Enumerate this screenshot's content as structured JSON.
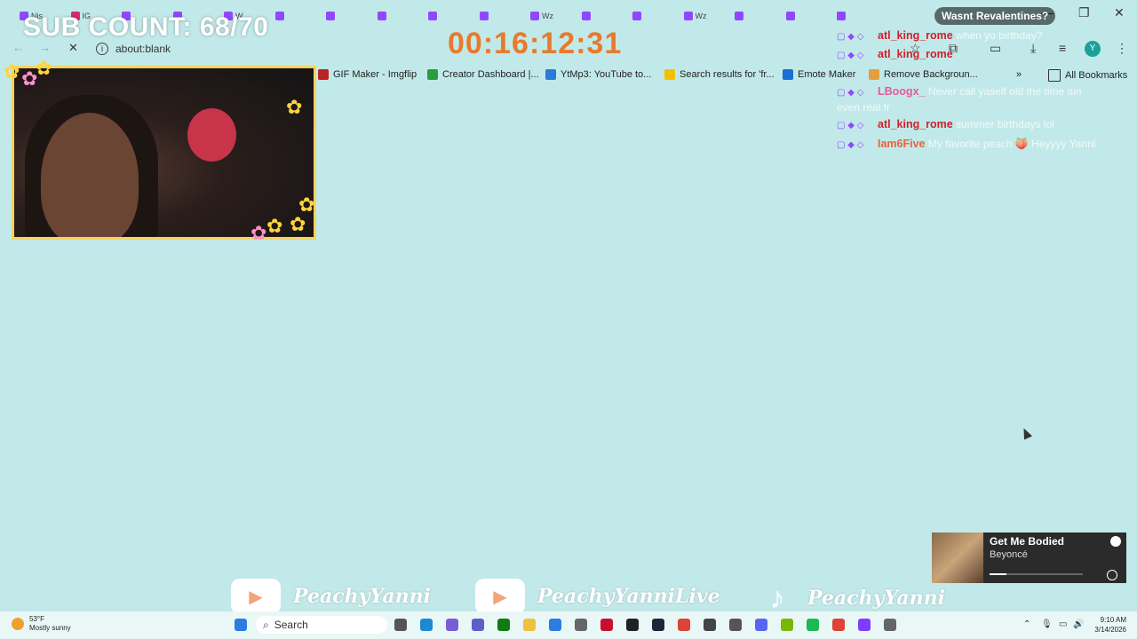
{
  "browser": {
    "tabs": [
      {
        "label": "Nis",
        "icon": "twitch-icon",
        "color": "#9147ff"
      },
      {
        "label": "IG",
        "icon": "instagram-icon",
        "color": "#d62976"
      },
      {
        "label": "",
        "icon": "twitch-icon",
        "color": "#9147ff"
      },
      {
        "label": "",
        "icon": "twitch-icon",
        "color": "#9147ff"
      },
      {
        "label": "W",
        "icon": "twitch-icon",
        "color": "#9147ff"
      },
      {
        "label": "",
        "icon": "twitch-icon",
        "color": "#9147ff"
      },
      {
        "label": "",
        "icon": "twitch-icon",
        "color": "#9147ff"
      },
      {
        "label": "",
        "icon": "twitch-icon",
        "color": "#9147ff"
      },
      {
        "label": "",
        "icon": "twitch-icon",
        "color": "#9147ff"
      },
      {
        "label": "",
        "icon": "twitch-icon",
        "color": "#9147ff"
      },
      {
        "label": "Wz",
        "icon": "twitch-icon",
        "color": "#9147ff"
      },
      {
        "label": "",
        "icon": "twitch-icon",
        "color": "#9147ff"
      },
      {
        "label": "",
        "icon": "twitch-icon",
        "color": "#9147ff"
      },
      {
        "label": "Wz",
        "icon": "twitch-icon",
        "color": "#9147ff"
      },
      {
        "label": "",
        "icon": "twitch-icon",
        "color": "#9147ff"
      },
      {
        "label": "",
        "icon": "twitch-icon",
        "color": "#9147ff"
      },
      {
        "label": "",
        "icon": "twitch-icon",
        "color": "#9147ff"
      }
    ],
    "url": "about:blank",
    "avatar_letter": "Y",
    "bookmarks": [
      {
        "label": "GIF Maker - Imgflip",
        "color": "#b22"
      },
      {
        "label": "Creator Dashboard |...",
        "color": "#2a9d3a"
      },
      {
        "label": "YtMp3: YouTube to...",
        "color": "#2b7bd6"
      },
      {
        "label": "Search results for 'fr...",
        "color": "#f2c200"
      },
      {
        "label": "Emote Maker",
        "color": "#1a6fd6"
      },
      {
        "label": "Remove Backgroun...",
        "color": "#e0a040"
      }
    ],
    "all_bookmarks": "All Bookmarks"
  },
  "overlay": {
    "sub_count": "SUB COUNT: 68/70",
    "timer": "00:16:12:31"
  },
  "chat": {
    "bubble": "Wasnt Revalentines?",
    "messages": [
      {
        "user": "atl_king_rome",
        "color": "#d0202a",
        "text": "when yo birthday?"
      },
      {
        "user": "atl_king_rome",
        "color": "#d0202a",
        "text": ""
      },
      {
        "user": "LBoogx_",
        "color": "#e35a9c",
        "text": "Never call yaself old the time ain even real fr"
      },
      {
        "user": "atl_king_rome",
        "color": "#d0202a",
        "text": "summer birthdays lol"
      },
      {
        "user": "Iam6Five",
        "color": "#e8643c",
        "text": "My favorite peach 🍑 Heyyyy Yanni"
      }
    ]
  },
  "now_playing": {
    "song": "Get Me Bodied",
    "artist": "Beyoncé",
    "progress": 0.18
  },
  "socials": [
    {
      "platform": "youtube",
      "name": "PeachyYanni"
    },
    {
      "platform": "youtube",
      "name": "PeachyYanniLive"
    },
    {
      "platform": "tiktok",
      "name": "PeachyYanni"
    }
  ],
  "taskbar": {
    "temp": "53°F",
    "weather": "Mostly sunny",
    "search": "Search",
    "time": "9:10 AM",
    "date": "3/14/2026"
  }
}
